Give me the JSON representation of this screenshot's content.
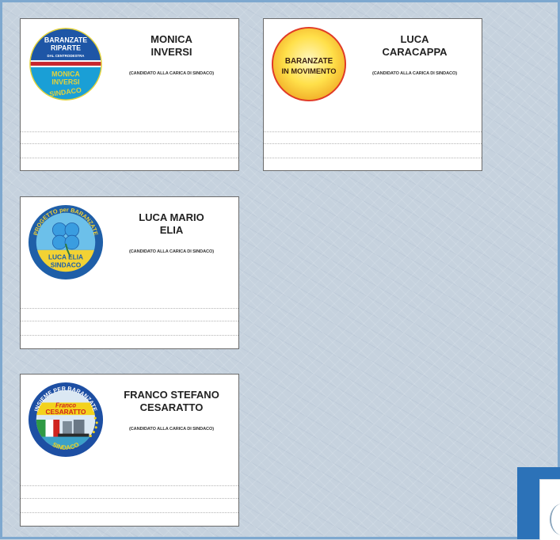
{
  "candidates": [
    {
      "name_line1": "MONICA",
      "name_line2": "INVERSI",
      "role": "(CANDIDATO ALLA CARICA DI SINDACO)",
      "logo": {
        "name": "baranzate-riparte-logo",
        "line1": "BARANZATE",
        "line2": "RIPARTE",
        "line3": "DAL CENTRODESTRA",
        "line4": "MONICA",
        "line5": "INVERSI",
        "line6": "SINDACO",
        "colors": {
          "top": "#1e56a6",
          "bottom": "#1a9fd6",
          "band": "#c9252c",
          "accent": "#e3d23b"
        }
      }
    },
    {
      "name_line1": "LUCA",
      "name_line2": "CARACAPPA",
      "role": "(CANDIDATO ALLA CARICA DI SINDACO)",
      "logo": {
        "name": "baranzate-in-movimento-logo",
        "line1": "BARANZATE",
        "line2": "IN MOVIMENTO",
        "colors": {
          "fill": "#ffe04a",
          "glow": "#fff7c0",
          "ring": "#e03a26",
          "text": "#3a1f10"
        }
      }
    },
    {
      "name_line1": "LUCA MARIO",
      "name_line2": "ELIA",
      "role": "(CANDIDATO ALLA CARICA DI SINDACO)",
      "logo": {
        "name": "progetto-per-baranzate-logo",
        "arc_text": "PROGETTO per BARANZATE",
        "line1": "LUCA ELIA",
        "line2": "SINDACO",
        "colors": {
          "ring": "#1f5fa8",
          "sky": "#6cc0ea",
          "ground": "#f2d234",
          "clover": "#3a9de0"
        }
      }
    },
    {
      "name_line1": "FRANCO STEFANO",
      "name_line2": "CESARATTO",
      "role": "(CANDIDATO ALLA CARICA DI SINDACO)",
      "logo": {
        "name": "insieme-per-baranzate-logo",
        "arc_text": "INSIEME PER BARANZATE",
        "line1": "Franco",
        "line2": "CESARATTO",
        "line3": "SINDACO",
        "colors": {
          "ring": "#1d4fa3",
          "name_bg": "#f3d21d",
          "name_text": "#d0241f",
          "flag_green": "#2f9a45",
          "flag_red": "#d0241f"
        }
      }
    }
  ]
}
